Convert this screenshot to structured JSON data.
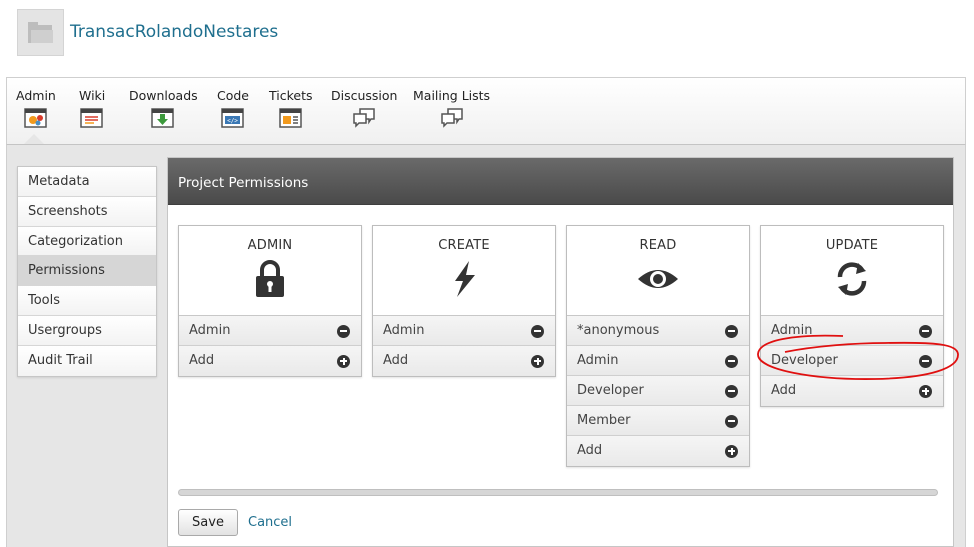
{
  "project": {
    "name": "TransacRolandoNestares"
  },
  "tools": [
    {
      "label": "Admin",
      "icon": "admin-icon"
    },
    {
      "label": "Wiki",
      "icon": "wiki-icon"
    },
    {
      "label": "Downloads",
      "icon": "download-icon"
    },
    {
      "label": "Code",
      "icon": "code-icon"
    },
    {
      "label": "Tickets",
      "icon": "tickets-icon"
    },
    {
      "label": "Discussion",
      "icon": "discussion-icon"
    },
    {
      "label": "Mailing Lists",
      "icon": "mailing-lists-icon"
    }
  ],
  "sidebar": {
    "items": [
      {
        "label": "Metadata"
      },
      {
        "label": "Screenshots"
      },
      {
        "label": "Categorization"
      },
      {
        "label": "Permissions",
        "active": true
      },
      {
        "label": "Tools"
      },
      {
        "label": "Usergroups"
      },
      {
        "label": "Audit Trail"
      }
    ]
  },
  "panel": {
    "title": "Project Permissions"
  },
  "permissions": {
    "admin": {
      "title": "ADMIN",
      "icon": "lock-icon",
      "rows": [
        "Admin"
      ],
      "add_label": "Add"
    },
    "create": {
      "title": "CREATE",
      "icon": "lightning-icon",
      "rows": [
        "Admin"
      ],
      "add_label": "Add"
    },
    "read": {
      "title": "READ",
      "icon": "eye-icon",
      "rows": [
        "*anonymous",
        "Admin",
        "Developer",
        "Member"
      ],
      "add_label": "Add"
    },
    "update": {
      "title": "UPDATE",
      "icon": "refresh-icon",
      "rows": [
        "Admin",
        "Developer"
      ],
      "add_label": "Add"
    }
  },
  "actions": {
    "save_label": "Save",
    "cancel_label": "Cancel"
  },
  "colors": {
    "link": "#1f6f8e",
    "header_bg": "#555555",
    "annotation": "#e01010"
  }
}
